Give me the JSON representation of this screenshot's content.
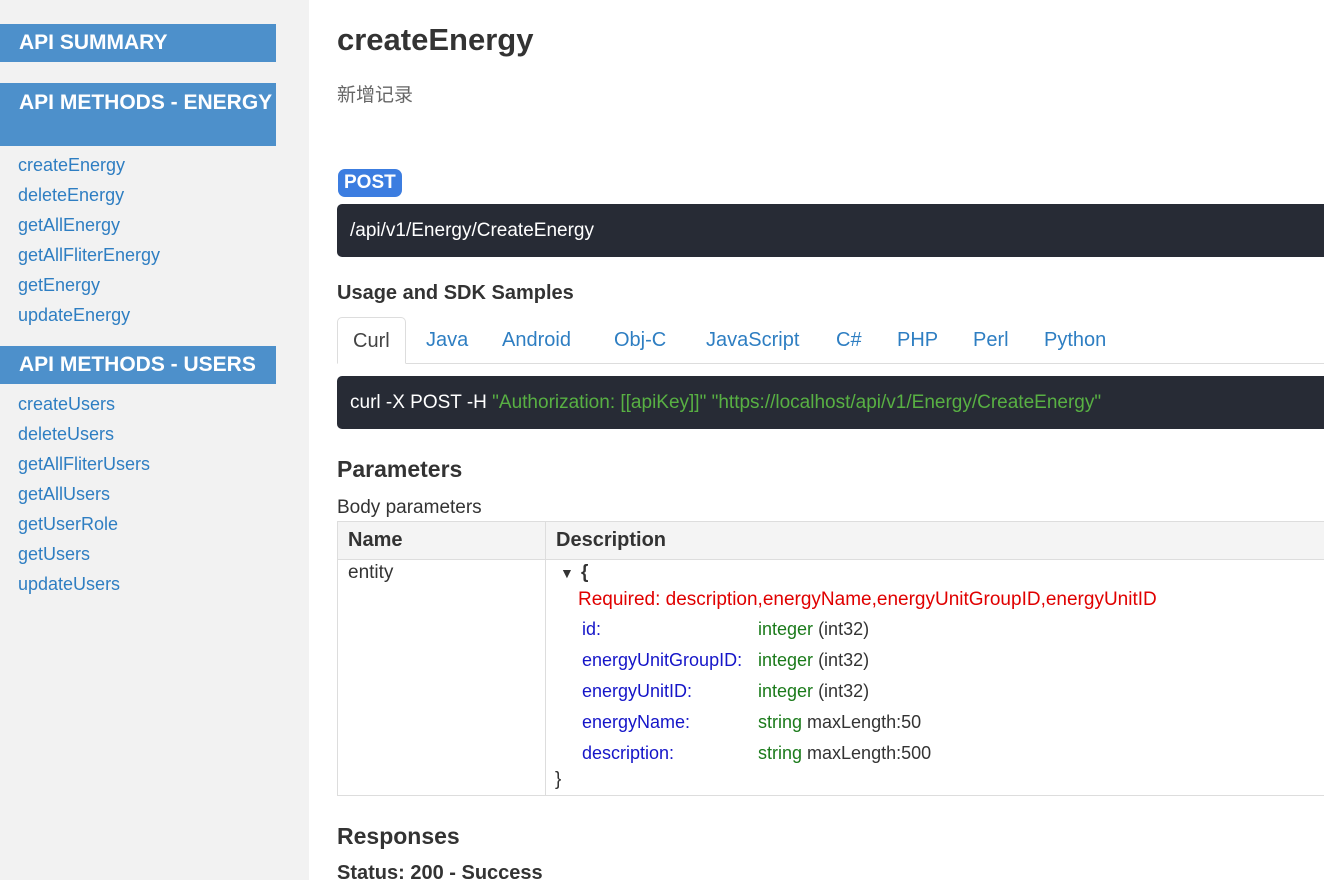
{
  "sidebar": {
    "summary_header": "API SUMMARY",
    "energy_header": "API METHODS - ENERGY",
    "energy_items": [
      "createEnergy",
      "deleteEnergy",
      "getAllEnergy",
      "getAllFliterEnergy",
      "getEnergy",
      "updateEnergy"
    ],
    "users_header": "API METHODS - USERS",
    "users_items": [
      "createUsers",
      "deleteUsers",
      "getAllFliterUsers",
      "getAllUsers",
      "getUserRole",
      "getUsers",
      "updateUsers"
    ]
  },
  "main": {
    "title": "createEnergy",
    "subtitle": "新增记录",
    "method": "POST",
    "endpoint": "/api/v1/Energy/CreateEnergy",
    "usage_heading": "Usage and SDK Samples",
    "tabs": [
      "Curl",
      "Java",
      "Android",
      "Obj-C",
      "JavaScript",
      "C#",
      "PHP",
      "Perl",
      "Python"
    ],
    "active_tab": "Curl",
    "curl": {
      "prefix": "curl -X POST -H ",
      "auth": "\"Authorization: [[apiKey]]\"",
      "url": "\"https://localhost/api/v1/Energy/CreateEnergy\""
    },
    "parameters_heading": "Parameters",
    "body_params_label": "Body parameters",
    "table": {
      "col_name": "Name",
      "col_description": "Description",
      "row_name": "entity",
      "toggle": "▼",
      "open_brace": "{",
      "close_brace": "}",
      "required": "Required: description,energyName,energyUnitGroupID,energyUnitID",
      "props": [
        {
          "name": "id:",
          "type": "integer",
          "extra": "(int32)"
        },
        {
          "name": "energyUnitGroupID:",
          "type": "integer",
          "extra": "(int32)"
        },
        {
          "name": "energyUnitID:",
          "type": "integer",
          "extra": "(int32)"
        },
        {
          "name": "energyName:",
          "type": "string",
          "extra": "maxLength:50"
        },
        {
          "name": "description:",
          "type": "string",
          "extra": "maxLength:500"
        }
      ]
    },
    "responses_heading": "Responses",
    "status_text": "Status: 200 - Success"
  }
}
